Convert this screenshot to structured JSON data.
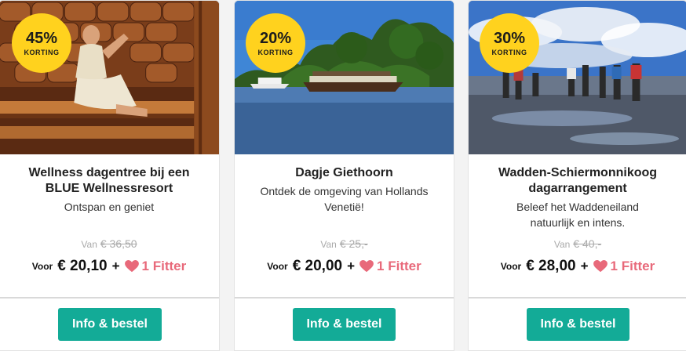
{
  "colors": {
    "badge": "#ffd21e",
    "button": "#13ab97",
    "fitter_accent": "#e8697a",
    "old_price": "#aaaaaa"
  },
  "cards": [
    {
      "discount": "45%",
      "discount_label": "KORTING",
      "title": "Wellness dagentree bij een BLUE Wellnessresort",
      "subtitle": "Ontspan en geniet",
      "old_price_prefix": "Van",
      "old_price": "€ 36,50",
      "new_price_prefix": "Voor",
      "new_price": "€ 20,10",
      "plus": "+",
      "fitter": "1 Fitter",
      "fitter_icon": "heart-icon",
      "button_label": "Info & bestel",
      "image": "sauna"
    },
    {
      "discount": "20%",
      "discount_label": "KORTING",
      "title": "Dagje Giethoorn",
      "subtitle": "Ontdek de omgeving van Hollands Venetië!",
      "old_price_prefix": "Van",
      "old_price": "€ 25,-",
      "new_price_prefix": "Voor",
      "new_price": "€ 20,00",
      "plus": "+",
      "fitter": "1 Fitter",
      "fitter_icon": "heart-icon",
      "button_label": "Info & bestel",
      "image": "boat-on-lake"
    },
    {
      "discount": "30%",
      "discount_label": "KORTING",
      "title": "Wadden-Schiermonnikoog dagarrangement",
      "subtitle": "Beleef het Waddeneiland natuurlijk en intens.",
      "old_price_prefix": "Van",
      "old_price": "€ 40,-",
      "new_price_prefix": "Voor",
      "new_price": "€ 28,00",
      "plus": "+",
      "fitter": "1 Fitter",
      "fitter_icon": "heart-icon",
      "button_label": "Info & bestel",
      "image": "mudflat-hikers"
    }
  ]
}
